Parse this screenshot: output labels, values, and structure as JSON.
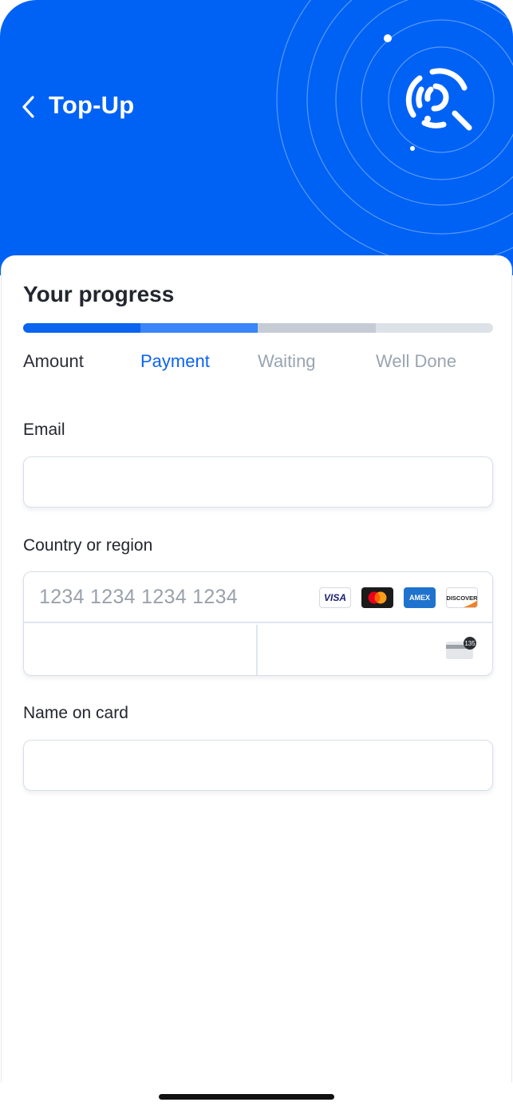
{
  "header": {
    "title": "Top-Up",
    "back_icon": "chevron-left-icon",
    "logo_icon": "brand-logo-icon",
    "background_color": "#0062f5"
  },
  "progress": {
    "heading": "Your progress",
    "current_step": 2,
    "steps": [
      {
        "label": "Amount",
        "state": "done",
        "color": "#0a64f0"
      },
      {
        "label": "Payment",
        "state": "active",
        "color": "#3a85f7"
      },
      {
        "label": "Waiting",
        "state": "pending",
        "color": "#c5ccd6"
      },
      {
        "label": "Well Done",
        "state": "pending",
        "color": "#dde2e8"
      }
    ]
  },
  "form": {
    "email": {
      "label": "Email",
      "value": "",
      "placeholder": ""
    },
    "country": {
      "label": "Country or region"
    },
    "card_number": {
      "placeholder": "1234 1234 1234 1234",
      "value": ""
    },
    "card_brands": [
      {
        "name": "visa-icon",
        "text": "VISA"
      },
      {
        "name": "mastercard-icon",
        "text": ""
      },
      {
        "name": "amex-icon",
        "text": "AMEX"
      },
      {
        "name": "discover-icon",
        "text": "DISCOVER"
      }
    ],
    "expiry": {
      "value": "",
      "placeholder": ""
    },
    "cvc": {
      "value": "",
      "placeholder": "",
      "icon": "cvc-card-icon",
      "icon_text": "135"
    },
    "name_on_card": {
      "label": "Name on card",
      "value": "",
      "placeholder": ""
    }
  }
}
